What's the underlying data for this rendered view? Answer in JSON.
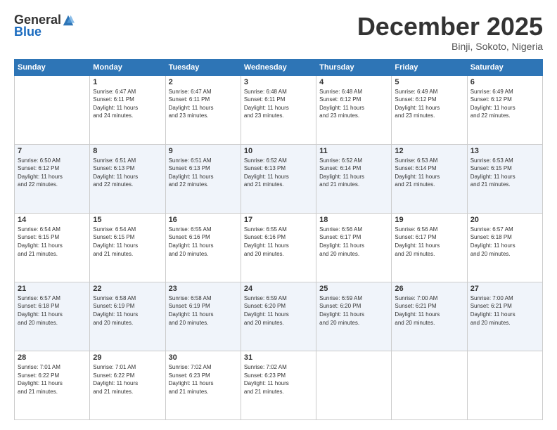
{
  "logo": {
    "general": "General",
    "blue": "Blue"
  },
  "title": "December 2025",
  "location": "Binji, Sokoto, Nigeria",
  "days": [
    "Sunday",
    "Monday",
    "Tuesday",
    "Wednesday",
    "Thursday",
    "Friday",
    "Saturday"
  ],
  "weeks": [
    [
      {
        "num": "",
        "lines": []
      },
      {
        "num": "1",
        "lines": [
          "Sunrise: 6:47 AM",
          "Sunset: 6:11 PM",
          "Daylight: 11 hours",
          "and 24 minutes."
        ]
      },
      {
        "num": "2",
        "lines": [
          "Sunrise: 6:47 AM",
          "Sunset: 6:11 PM",
          "Daylight: 11 hours",
          "and 23 minutes."
        ]
      },
      {
        "num": "3",
        "lines": [
          "Sunrise: 6:48 AM",
          "Sunset: 6:11 PM",
          "Daylight: 11 hours",
          "and 23 minutes."
        ]
      },
      {
        "num": "4",
        "lines": [
          "Sunrise: 6:48 AM",
          "Sunset: 6:12 PM",
          "Daylight: 11 hours",
          "and 23 minutes."
        ]
      },
      {
        "num": "5",
        "lines": [
          "Sunrise: 6:49 AM",
          "Sunset: 6:12 PM",
          "Daylight: 11 hours",
          "and 23 minutes."
        ]
      },
      {
        "num": "6",
        "lines": [
          "Sunrise: 6:49 AM",
          "Sunset: 6:12 PM",
          "Daylight: 11 hours",
          "and 22 minutes."
        ]
      }
    ],
    [
      {
        "num": "7",
        "lines": [
          "Sunrise: 6:50 AM",
          "Sunset: 6:12 PM",
          "Daylight: 11 hours",
          "and 22 minutes."
        ]
      },
      {
        "num": "8",
        "lines": [
          "Sunrise: 6:51 AM",
          "Sunset: 6:13 PM",
          "Daylight: 11 hours",
          "and 22 minutes."
        ]
      },
      {
        "num": "9",
        "lines": [
          "Sunrise: 6:51 AM",
          "Sunset: 6:13 PM",
          "Daylight: 11 hours",
          "and 22 minutes."
        ]
      },
      {
        "num": "10",
        "lines": [
          "Sunrise: 6:52 AM",
          "Sunset: 6:13 PM",
          "Daylight: 11 hours",
          "and 21 minutes."
        ]
      },
      {
        "num": "11",
        "lines": [
          "Sunrise: 6:52 AM",
          "Sunset: 6:14 PM",
          "Daylight: 11 hours",
          "and 21 minutes."
        ]
      },
      {
        "num": "12",
        "lines": [
          "Sunrise: 6:53 AM",
          "Sunset: 6:14 PM",
          "Daylight: 11 hours",
          "and 21 minutes."
        ]
      },
      {
        "num": "13",
        "lines": [
          "Sunrise: 6:53 AM",
          "Sunset: 6:15 PM",
          "Daylight: 11 hours",
          "and 21 minutes."
        ]
      }
    ],
    [
      {
        "num": "14",
        "lines": [
          "Sunrise: 6:54 AM",
          "Sunset: 6:15 PM",
          "Daylight: 11 hours",
          "and 21 minutes."
        ]
      },
      {
        "num": "15",
        "lines": [
          "Sunrise: 6:54 AM",
          "Sunset: 6:15 PM",
          "Daylight: 11 hours",
          "and 21 minutes."
        ]
      },
      {
        "num": "16",
        "lines": [
          "Sunrise: 6:55 AM",
          "Sunset: 6:16 PM",
          "Daylight: 11 hours",
          "and 20 minutes."
        ]
      },
      {
        "num": "17",
        "lines": [
          "Sunrise: 6:55 AM",
          "Sunset: 6:16 PM",
          "Daylight: 11 hours",
          "and 20 minutes."
        ]
      },
      {
        "num": "18",
        "lines": [
          "Sunrise: 6:56 AM",
          "Sunset: 6:17 PM",
          "Daylight: 11 hours",
          "and 20 minutes."
        ]
      },
      {
        "num": "19",
        "lines": [
          "Sunrise: 6:56 AM",
          "Sunset: 6:17 PM",
          "Daylight: 11 hours",
          "and 20 minutes."
        ]
      },
      {
        "num": "20",
        "lines": [
          "Sunrise: 6:57 AM",
          "Sunset: 6:18 PM",
          "Daylight: 11 hours",
          "and 20 minutes."
        ]
      }
    ],
    [
      {
        "num": "21",
        "lines": [
          "Sunrise: 6:57 AM",
          "Sunset: 6:18 PM",
          "Daylight: 11 hours",
          "and 20 minutes."
        ]
      },
      {
        "num": "22",
        "lines": [
          "Sunrise: 6:58 AM",
          "Sunset: 6:19 PM",
          "Daylight: 11 hours",
          "and 20 minutes."
        ]
      },
      {
        "num": "23",
        "lines": [
          "Sunrise: 6:58 AM",
          "Sunset: 6:19 PM",
          "Daylight: 11 hours",
          "and 20 minutes."
        ]
      },
      {
        "num": "24",
        "lines": [
          "Sunrise: 6:59 AM",
          "Sunset: 6:20 PM",
          "Daylight: 11 hours",
          "and 20 minutes."
        ]
      },
      {
        "num": "25",
        "lines": [
          "Sunrise: 6:59 AM",
          "Sunset: 6:20 PM",
          "Daylight: 11 hours",
          "and 20 minutes."
        ]
      },
      {
        "num": "26",
        "lines": [
          "Sunrise: 7:00 AM",
          "Sunset: 6:21 PM",
          "Daylight: 11 hours",
          "and 20 minutes."
        ]
      },
      {
        "num": "27",
        "lines": [
          "Sunrise: 7:00 AM",
          "Sunset: 6:21 PM",
          "Daylight: 11 hours",
          "and 20 minutes."
        ]
      }
    ],
    [
      {
        "num": "28",
        "lines": [
          "Sunrise: 7:01 AM",
          "Sunset: 6:22 PM",
          "Daylight: 11 hours",
          "and 21 minutes."
        ]
      },
      {
        "num": "29",
        "lines": [
          "Sunrise: 7:01 AM",
          "Sunset: 6:22 PM",
          "Daylight: 11 hours",
          "and 21 minutes."
        ]
      },
      {
        "num": "30",
        "lines": [
          "Sunrise: 7:02 AM",
          "Sunset: 6:23 PM",
          "Daylight: 11 hours",
          "and 21 minutes."
        ]
      },
      {
        "num": "31",
        "lines": [
          "Sunrise: 7:02 AM",
          "Sunset: 6:23 PM",
          "Daylight: 11 hours",
          "and 21 minutes."
        ]
      },
      {
        "num": "",
        "lines": []
      },
      {
        "num": "",
        "lines": []
      },
      {
        "num": "",
        "lines": []
      }
    ]
  ]
}
